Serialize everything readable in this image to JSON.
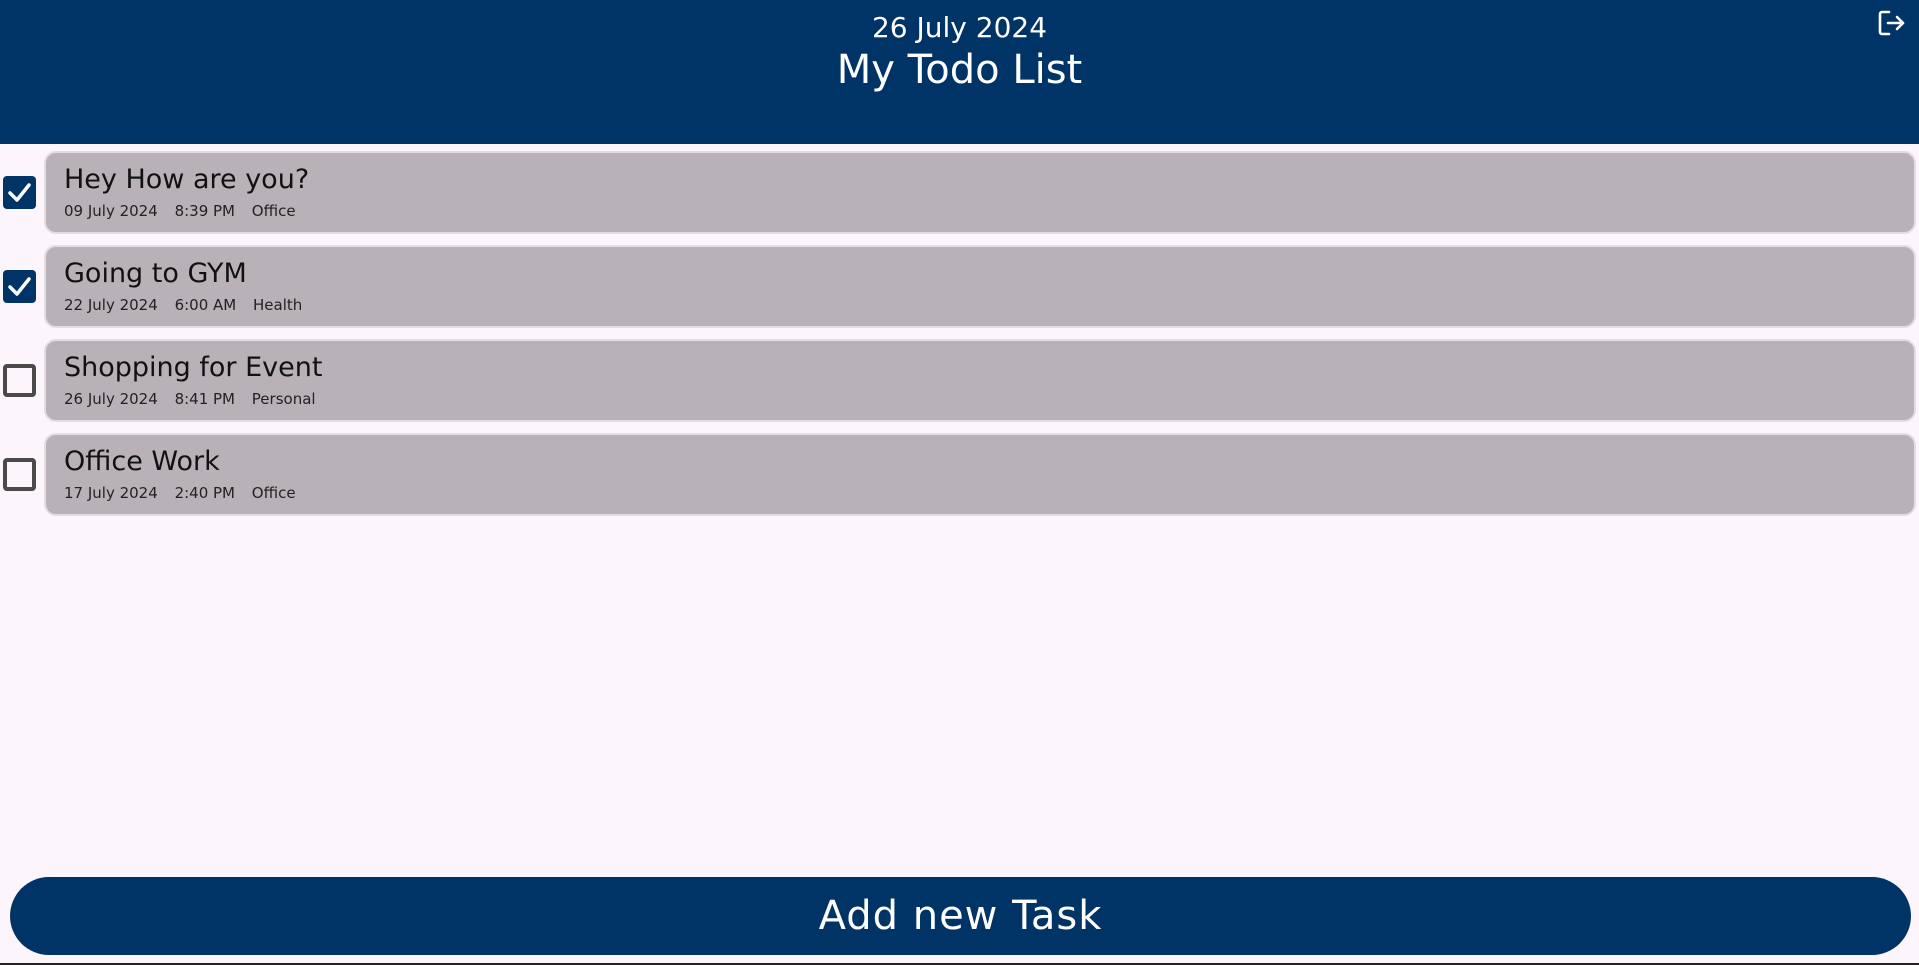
{
  "header": {
    "date": "26 July 2024",
    "title": "My Todo List",
    "logout_icon": "logout-icon"
  },
  "tasks": [
    {
      "title": "Hey How are you?",
      "date": "09 July 2024",
      "time": "8:39 PM",
      "category": "Office",
      "completed": true
    },
    {
      "title": "Going to GYM",
      "date": "22 July 2024",
      "time": "6:00 AM",
      "category": "Health",
      "completed": true
    },
    {
      "title": "Shopping for Event",
      "date": "26 July 2024",
      "time": "8:41 PM",
      "category": "Personal",
      "completed": false
    },
    {
      "title": "Office Work",
      "date": "17 July 2024",
      "time": "2:40 PM",
      "category": "Office",
      "completed": false
    }
  ],
  "actions": {
    "add_task_label": "Add new Task"
  },
  "colors": {
    "primary": "#003366",
    "card": "#b8b1b8",
    "background": "#fcf5fc"
  }
}
